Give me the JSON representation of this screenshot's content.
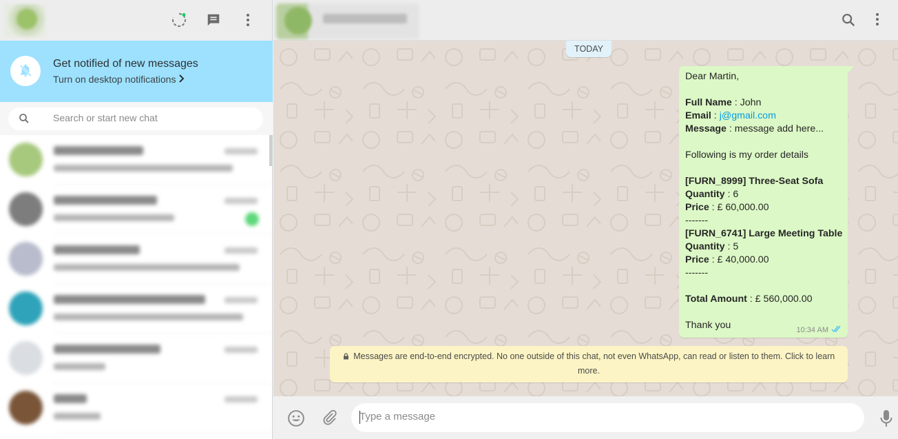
{
  "sidebar": {
    "header": {
      "icons": [
        "status-icon",
        "new-chat-icon",
        "menu-icon"
      ]
    },
    "notification": {
      "title": "Get notified of new messages",
      "subtitle": "Turn on desktop notifications",
      "icon": "bell-off-icon"
    },
    "search": {
      "placeholder": "Search or start new chat"
    },
    "chats": [
      {
        "avatar_color": "#a7c97d",
        "name_w": 130,
        "prev_w": 260,
        "badge": false
      },
      {
        "avatar_color": "#7d7d7d",
        "name_w": 150,
        "prev_w": 175,
        "badge": true
      },
      {
        "avatar_color": "#b8bccc",
        "name_w": 125,
        "prev_w": 270,
        "badge": false
      },
      {
        "avatar_color": "#2fa3b9",
        "name_w": 220,
        "prev_w": 275,
        "badge": false
      },
      {
        "avatar_color": "#dadde2",
        "name_w": 155,
        "prev_w": 75,
        "badge": false
      },
      {
        "avatar_color": "#7a5538",
        "name_w": 48,
        "prev_w": 68,
        "badge": false
      }
    ]
  },
  "conversation": {
    "header": {
      "icons": [
        "search-icon",
        "menu-icon"
      ]
    },
    "day_label": "TODAY",
    "message": {
      "lines": [
        {
          "text": "Dear Martin,"
        },
        {
          "text": ""
        },
        {
          "label": "Full Name",
          "value": " : John"
        },
        {
          "label": "Email",
          "value": " : ",
          "link": "j@gmail.com"
        },
        {
          "label": "Message",
          "value": " : message add here..."
        },
        {
          "text": ""
        },
        {
          "text": "Following is my order details"
        },
        {
          "text": ""
        },
        {
          "label": "[FURN_8999] Three-Seat Sofa",
          "value": ""
        },
        {
          "label": "Quantity",
          "value": " : 6"
        },
        {
          "label": "Price",
          "value": " : £ 60,000.00"
        },
        {
          "text": "-------"
        },
        {
          "label": "[FURN_6741] Large Meeting Table",
          "value": ""
        },
        {
          "label": "Quantity",
          "value": " : 5"
        },
        {
          "label": "Price",
          "value": " : £ 40,000.00"
        },
        {
          "text": "-------"
        },
        {
          "text": ""
        },
        {
          "label": "Total Amount",
          "value": " : £ 560,000.00"
        },
        {
          "text": ""
        },
        {
          "text": "Thank you"
        }
      ],
      "time": "10:34 AM",
      "status_icon": "double-check-icon"
    },
    "encryption_notice": "Messages are end-to-end encrypted. No one outside of this chat, not even WhatsApp, can read or listen to them. Click to learn more.",
    "composer": {
      "placeholder": "Type a message"
    }
  },
  "colors": {
    "notification_bg": "#9de1fe",
    "outgoing_bubble": "#dcf8c6",
    "chat_bg": "#e5ddd5",
    "link": "#039be5",
    "read_tick": "#4fc3f7"
  }
}
